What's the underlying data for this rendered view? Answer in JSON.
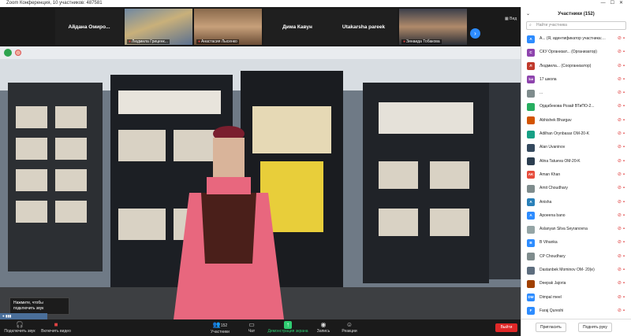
{
  "window": {
    "title": "Zoom Конференция, 10 участников: 487581"
  },
  "gallery": {
    "tiles": [
      {
        "name": "Айдана  Омиро...",
        "video": false
      },
      {
        "name": "Людмила Гриценк...",
        "video": true
      },
      {
        "name": "Анастасия Лысенко",
        "video": true
      },
      {
        "name": "Дима Кавун",
        "video": false
      },
      {
        "name": "Utakarsha pareek",
        "video": false
      },
      {
        "name": "Зинаида Тобакова",
        "video": true
      }
    ],
    "view_label": "Вид"
  },
  "sidebar": {
    "title": "Участники (152)",
    "search_placeholder": "Найти участника",
    "participants": [
      {
        "initials": "А",
        "color": "#2d8cff",
        "name": "А... (Я, идентификатор участника: 487581)"
      },
      {
        "initials": "С",
        "color": "#8e44ad",
        "name": "СКУ Организат... (Организатор)"
      },
      {
        "initials": "Л",
        "color": "#c0392b",
        "name": "Людмила... (Соорганизатор)"
      },
      {
        "initials": "1ш",
        "color": "#8e44ad",
        "name": "17 школа"
      },
      {
        "initials": "",
        "color": "#7f8c8d",
        "name": "..."
      },
      {
        "initials": "",
        "color": "#27ae60",
        "name": "Ордабекова Розай ВТиПО-2..."
      },
      {
        "initials": "",
        "color": "#d35400",
        "name": "Abhishek Bhargav"
      },
      {
        "initials": "",
        "color": "#16a085",
        "name": "Adilhan Orynbasar OM-20-K"
      },
      {
        "initials": "",
        "color": "#34495e",
        "name": "Alan Uvaninov"
      },
      {
        "initials": "",
        "color": "#2c3e50",
        "name": "Alina Tatueva OM-20-K"
      },
      {
        "initials": "AK",
        "color": "#e74c3c",
        "name": "Aman Khan"
      },
      {
        "initials": "",
        "color": "#7f8c8d",
        "name": "Amit Choudhary"
      },
      {
        "initials": "A",
        "color": "#2980b9",
        "name": "Anisha"
      },
      {
        "initials": "A",
        "color": "#2d8cff",
        "name": "Apoeena bano"
      },
      {
        "initials": "",
        "color": "#95a5a6",
        "name": "Aslanyan Silva Seyranovna"
      },
      {
        "initials": "B",
        "color": "#2d8cff",
        "name": "B Vihanka"
      },
      {
        "initials": "",
        "color": "#7f8c8d",
        "name": "CP Choudhary"
      },
      {
        "initials": "",
        "color": "#5d6d7e",
        "name": "Dastanbek Mominov OM- 20(e)"
      },
      {
        "initials": "",
        "color": "#a04000",
        "name": "Deepak Jajoria"
      },
      {
        "initials": "DM",
        "color": "#2d8cff",
        "name": "Dimpal meel"
      },
      {
        "initials": "F",
        "color": "#2d8cff",
        "name": "Faraj Qureshi"
      }
    ],
    "invite_label": "Пригласить",
    "raise_hand_label": "Поднять руку"
  },
  "tooltip": {
    "line1": "Нажмите, чтобы",
    "line2": "подключить звук"
  },
  "toolbar": {
    "audio_label": "Подключить звук",
    "video_label": "Включить видео",
    "participants_label": "Участники",
    "participants_count": "152",
    "chat_label": "Чат",
    "share_label": "Демонстрация экрана",
    "record_label": "Запись",
    "reactions_label": "Реакции",
    "leave_label": "Выйти"
  }
}
